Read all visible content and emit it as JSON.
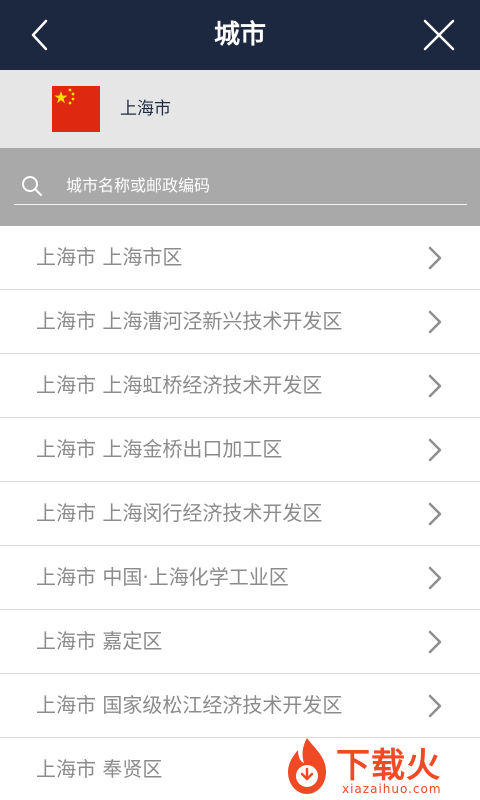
{
  "header": {
    "title": "城市",
    "back_icon": "chevron-left-icon",
    "close_icon": "close-icon",
    "background": "#1c2740"
  },
  "country": {
    "name": "上海市",
    "flag_icon": "china-flag-icon"
  },
  "search": {
    "placeholder": "城市名称或邮政编码",
    "value": "",
    "icon": "search-icon"
  },
  "cities": [
    {
      "label": "上海市 上海市区"
    },
    {
      "label": "上海市 上海漕河泾新兴技术开发区"
    },
    {
      "label": "上海市 上海虹桥经济技术开发区"
    },
    {
      "label": "上海市 上海金桥出口加工区"
    },
    {
      "label": "上海市 上海闵行经济技术开发区"
    },
    {
      "label": "上海市 中国·上海化学工业区"
    },
    {
      "label": "上海市 嘉定区"
    },
    {
      "label": "上海市 国家级松江经济技术开发区"
    },
    {
      "label": "上海市 奉贤区"
    }
  ],
  "watermark": {
    "brand": "下载火",
    "url": "xiazaihuo.com",
    "color": "#ef4a23"
  }
}
